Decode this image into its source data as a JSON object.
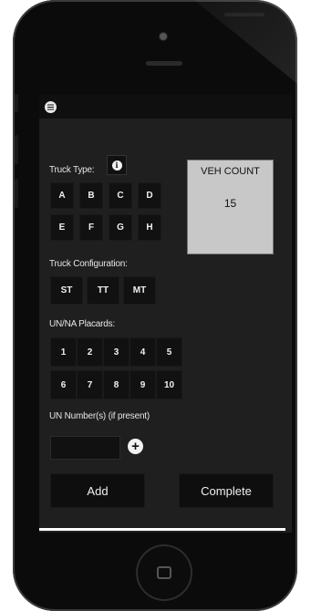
{
  "truck_type": {
    "label": "Truck Type:",
    "buttons": [
      "A",
      "B",
      "C",
      "D",
      "E",
      "F",
      "G",
      "H"
    ]
  },
  "veh_count": {
    "title": "VEH COUNT",
    "value": "15"
  },
  "truck_config": {
    "label": "Truck Configuration:",
    "buttons": [
      "ST",
      "TT",
      "MT"
    ]
  },
  "placards": {
    "label": "UN/NA Placards:",
    "buttons": [
      "1",
      "2",
      "3",
      "4",
      "5",
      "6",
      "7",
      "8",
      "9",
      "10"
    ]
  },
  "un_number": {
    "label": "UN Number(s) (if present)",
    "value": ""
  },
  "actions": {
    "add": "Add",
    "complete": "Complete"
  }
}
